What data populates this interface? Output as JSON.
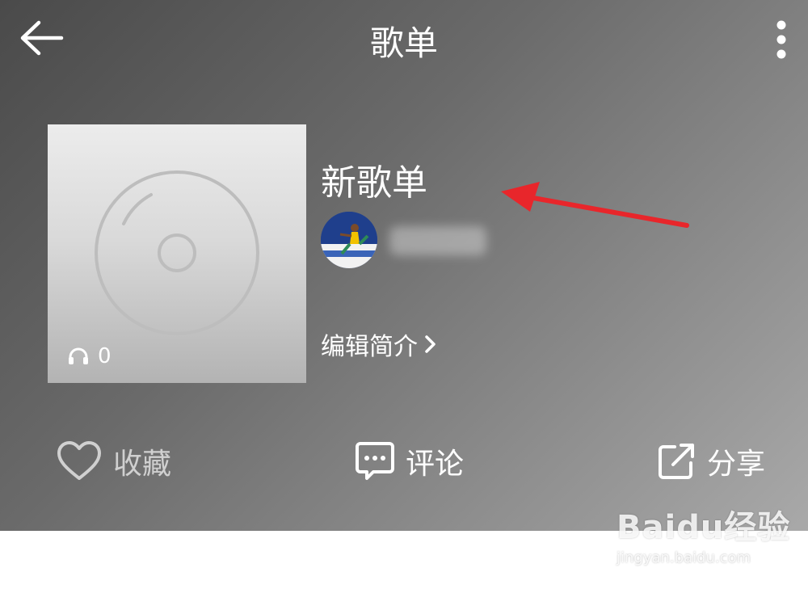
{
  "header": {
    "title": "歌单"
  },
  "playlist": {
    "name": "新歌单",
    "play_count": "0",
    "edit_intro_label": "编辑简介"
  },
  "actions": {
    "favorite_label": "收藏",
    "comment_label": "评论",
    "share_label": "分享"
  },
  "watermark": {
    "logo_text": "Baidu经验",
    "url": "jingyan.baidu.com"
  },
  "icons": [
    "back-arrow-icon",
    "more-vertical-icon",
    "disc-icon",
    "headphones-icon",
    "chevron-right-icon",
    "heart-icon",
    "comment-icon",
    "share-icon"
  ],
  "colors": {
    "annotation_arrow": "#e8262b",
    "text_primary": "#ffffff",
    "text_disabled": "#d0d0d0"
  }
}
